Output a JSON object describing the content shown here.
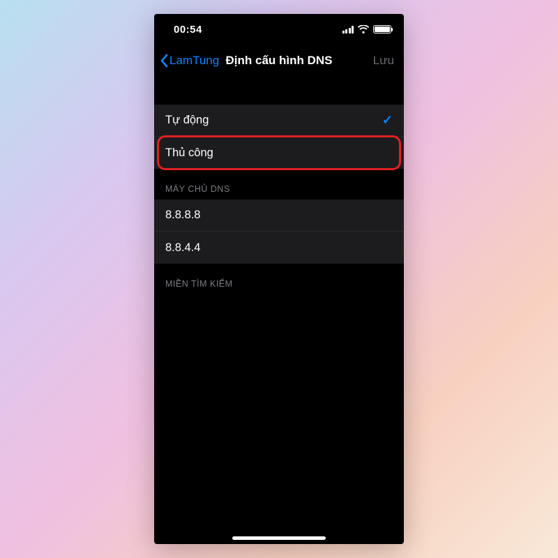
{
  "status_bar": {
    "time": "00:54"
  },
  "nav": {
    "back": "LamTung",
    "title": "Định cấu hình DNS",
    "save": "Lưu"
  },
  "options": {
    "auto": "Tự động",
    "manual": "Thủ công"
  },
  "sections": {
    "dns_servers_header": "MÁY CHỦ DNS",
    "search_domains_header": "MIỀN TÌM KIẾM"
  },
  "dns_servers": {
    "primary": "8.8.8.8",
    "secondary": "8.8.4.4"
  }
}
